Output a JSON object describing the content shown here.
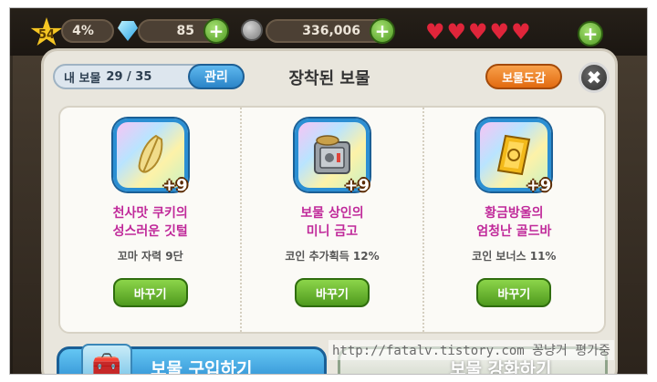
{
  "status": {
    "level": "54",
    "exp_percent": "4%",
    "gems": "85",
    "coins": "336,006",
    "hearts": 5
  },
  "modal": {
    "my_treasure_label": "내 보물",
    "my_treasure_count": "29 / 35",
    "manage_label": "관리",
    "title": "장착된 보물",
    "encyclopedia_label": "보물도감",
    "close_symbol": "✖"
  },
  "slots": [
    {
      "name_line1": "천사맛 쿠키의",
      "name_line2": "성스러운 깃털",
      "level": "+9",
      "effect": "꼬마 자력 9단",
      "swap_label": "바꾸기",
      "icon": "feather-icon"
    },
    {
      "name_line1": "보물 상인의",
      "name_line2": "미니 금고",
      "level": "+9",
      "effect": "코인 추가획득 12%",
      "swap_label": "바꾸기",
      "icon": "safe-icon"
    },
    {
      "name_line1": "황금방울의",
      "name_line2": "엄청난 골드바",
      "level": "+9",
      "effect": "코인 보너스 11%",
      "swap_label": "바꾸기",
      "icon": "gold-bar-icon"
    }
  ],
  "footer": {
    "buy_label": "보물 구입하기",
    "upgrade_label": "보물 강화하기"
  },
  "watermark": "http://fatalv.tistory.com 꽁냥거 평가중",
  "colors": {
    "item_name": "#c0299a",
    "swap_button": "#5aa626",
    "manage_button": "#2a84c8",
    "encyclopedia_button": "#e26a10"
  }
}
